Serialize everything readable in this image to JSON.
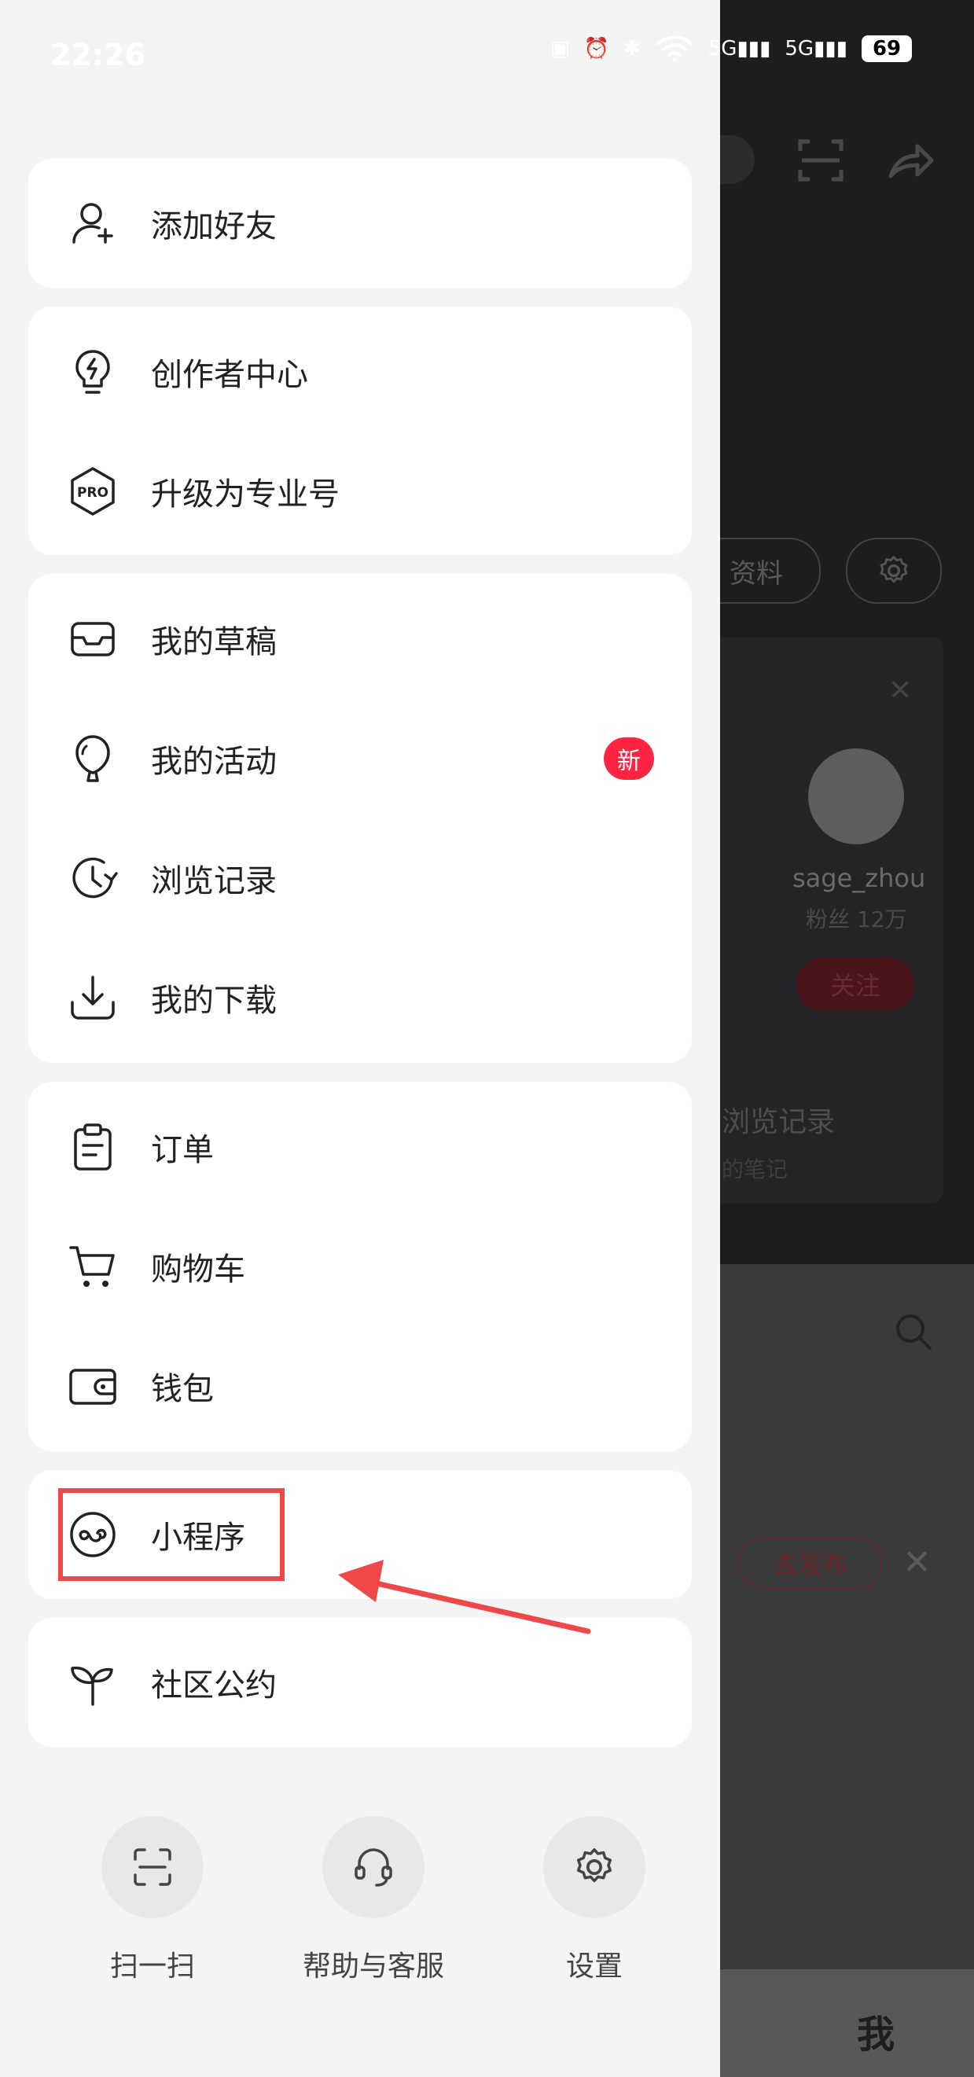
{
  "status_bar": {
    "time": "22:26",
    "net1": "5G",
    "net2": "5G",
    "battery": "69"
  },
  "background": {
    "profile_edit_chip": "资料",
    "account_name": "sage_zhou",
    "account_fans": "粉丝 12万",
    "follow_button": "关注",
    "history_title": "浏览记录",
    "history_sub": "的笔记",
    "publish_button": "去发布",
    "tab_me": "我"
  },
  "drawer": {
    "group1": [
      {
        "label": "添加好友",
        "icon": "add-user-icon"
      }
    ],
    "group2": [
      {
        "label": "创作者中心",
        "icon": "lightning-bulb-icon"
      },
      {
        "label": "升级为专业号",
        "icon": "pro-icon",
        "icon_text": "PRO"
      }
    ],
    "group3": [
      {
        "label": "我的草稿",
        "icon": "inbox-icon"
      },
      {
        "label": "我的活动",
        "icon": "balloon-icon",
        "badge": "新"
      },
      {
        "label": "浏览记录",
        "icon": "history-clock-icon"
      },
      {
        "label": "我的下载",
        "icon": "download-icon"
      }
    ],
    "group4": [
      {
        "label": "订单",
        "icon": "clipboard-icon"
      },
      {
        "label": "购物车",
        "icon": "cart-icon"
      },
      {
        "label": "钱包",
        "icon": "wallet-icon"
      }
    ],
    "group5": [
      {
        "label": "小程序",
        "icon": "mini-program-icon"
      }
    ],
    "group6": [
      {
        "label": "社区公约",
        "icon": "sprout-icon"
      }
    ],
    "quick_actions": [
      {
        "label": "扫一扫",
        "icon": "scan-icon"
      },
      {
        "label": "帮助与客服",
        "icon": "headset-icon"
      },
      {
        "label": "设置",
        "icon": "gear-icon"
      }
    ]
  },
  "colors": {
    "accent": "#ff2442",
    "highlight": "#f04848"
  }
}
